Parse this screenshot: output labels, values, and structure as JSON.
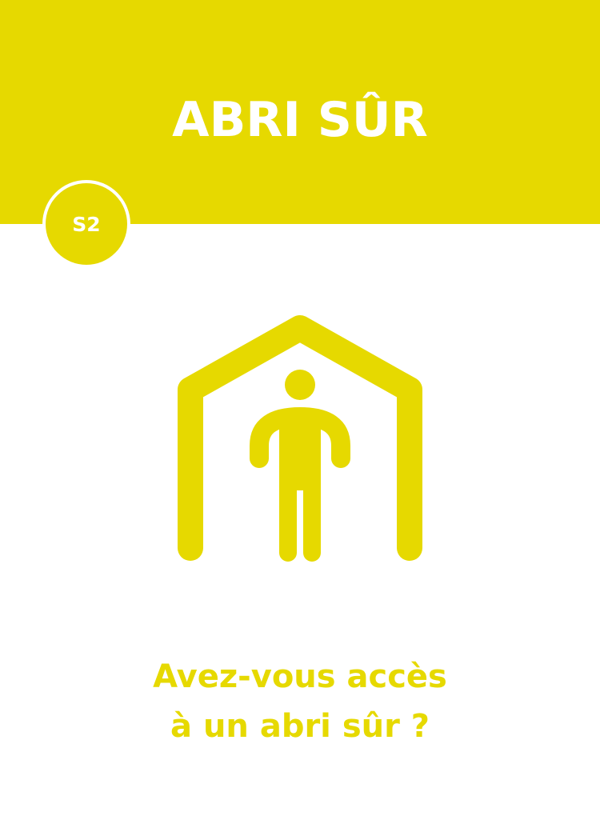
{
  "card": {
    "title": "ABRI SÛR",
    "code": "S2",
    "question_line1": "Avez-vous accès",
    "question_line2": "à un abri sûr ?",
    "icon": "person-in-house-icon"
  },
  "colors": {
    "accent": "#E6D900",
    "background": "#ffffff",
    "title_text": "#ffffff"
  }
}
